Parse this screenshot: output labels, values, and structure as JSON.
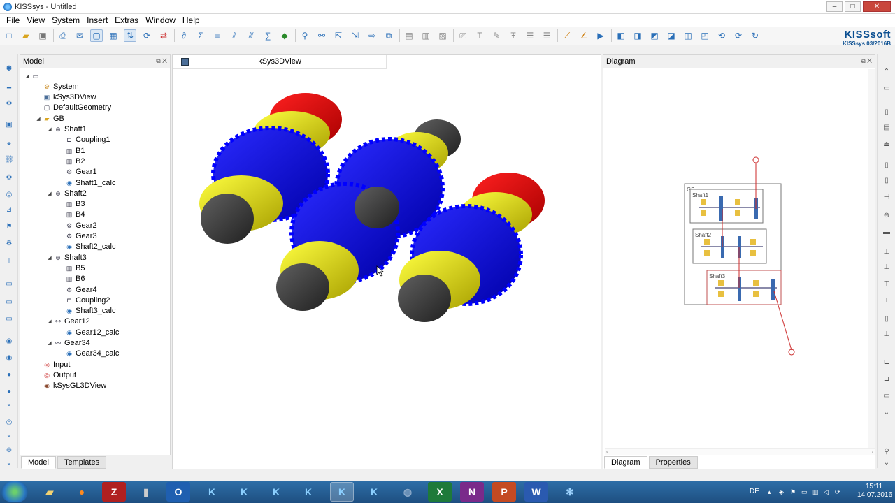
{
  "window": {
    "title": "KISSsys - Untitled",
    "ctrl_min": "–",
    "ctrl_max": "□",
    "ctrl_close": "✕"
  },
  "menu": [
    "File",
    "View",
    "System",
    "Insert",
    "Extras",
    "Window",
    "Help"
  ],
  "brand": {
    "logo": "KISSsoft",
    "version": "KISSsys 03/2016B"
  },
  "model_pane": {
    "title": "Model",
    "tree": [
      {
        "label": "",
        "icon": "root-icon",
        "indent": 0,
        "expander": "◢"
      },
      {
        "label": "System",
        "icon": "system-icon",
        "indent": 1
      },
      {
        "label": "kSys3DView",
        "icon": "view3d-icon",
        "indent": 1
      },
      {
        "label": "DefaultGeometry",
        "icon": "geometry-icon",
        "indent": 1
      },
      {
        "label": "GB",
        "icon": "folder-icon",
        "indent": 1,
        "expander": "◢"
      },
      {
        "label": "Shaft1",
        "icon": "shaft-icon",
        "indent": 2,
        "expander": "◢"
      },
      {
        "label": "Coupling1",
        "icon": "coupling-icon",
        "indent": 3
      },
      {
        "label": "B1",
        "icon": "bearing-icon",
        "indent": 3
      },
      {
        "label": "B2",
        "icon": "bearing-icon",
        "indent": 3
      },
      {
        "label": "Gear1",
        "icon": "gear-icon",
        "indent": 3
      },
      {
        "label": "Shaft1_calc",
        "icon": "calc-icon",
        "indent": 3
      },
      {
        "label": "Shaft2",
        "icon": "shaft-icon",
        "indent": 2,
        "expander": "◢"
      },
      {
        "label": "B3",
        "icon": "bearing-icon",
        "indent": 3
      },
      {
        "label": "B4",
        "icon": "bearing-icon",
        "indent": 3
      },
      {
        "label": "Gear2",
        "icon": "gear-icon",
        "indent": 3
      },
      {
        "label": "Gear3",
        "icon": "gear-icon",
        "indent": 3
      },
      {
        "label": "Shaft2_calc",
        "icon": "calc-icon",
        "indent": 3
      },
      {
        "label": "Shaft3",
        "icon": "shaft-icon",
        "indent": 2,
        "expander": "◢"
      },
      {
        "label": "B5",
        "icon": "bearing-icon",
        "indent": 3
      },
      {
        "label": "B6",
        "icon": "bearing-icon",
        "indent": 3
      },
      {
        "label": "Gear4",
        "icon": "gear-icon",
        "indent": 3
      },
      {
        "label": "Coupling2",
        "icon": "coupling-icon",
        "indent": 3
      },
      {
        "label": "Shaft3_calc",
        "icon": "calc-icon",
        "indent": 3
      },
      {
        "label": "Gear12",
        "icon": "gearpair-icon",
        "indent": 2,
        "expander": "◢"
      },
      {
        "label": "Gear12_calc",
        "icon": "calc-icon",
        "indent": 3
      },
      {
        "label": "Gear34",
        "icon": "gearpair-icon",
        "indent": 2,
        "expander": "◢"
      },
      {
        "label": "Gear34_calc",
        "icon": "calc-icon",
        "indent": 3
      },
      {
        "label": "Input",
        "icon": "input-icon",
        "indent": 1
      },
      {
        "label": "Output",
        "icon": "output-icon",
        "indent": 1
      },
      {
        "label": "kSysGL3DView",
        "icon": "glview-icon",
        "indent": 1
      }
    ],
    "tabs": [
      "Model",
      "Templates"
    ]
  },
  "view3d": {
    "tab_label": "kSys3DView"
  },
  "diagram": {
    "title": "Diagram",
    "tabs": [
      "Diagram",
      "Properties"
    ],
    "gb_label": "GB",
    "shaft_labels": [
      "Shaft1",
      "Shaft2",
      "Shaft3"
    ]
  },
  "colors": {
    "gear": "#1212e0",
    "bearing": "#e0dd10",
    "coupling": "#e01010",
    "shaft": "#505050",
    "link": "#cc2a2a"
  },
  "taskbar": {
    "apps": [
      "explorer",
      "firefox",
      "filezilla",
      "usb",
      "outlook",
      "kisssoft",
      "kisssoft",
      "kisssoft",
      "kisssoft",
      "kisssys",
      "kisssoft",
      "network",
      "excel",
      "onenote",
      "powerpoint",
      "word",
      "snowflake"
    ],
    "lang": "DE",
    "time": "15:11",
    "date": "14.07.2016"
  }
}
